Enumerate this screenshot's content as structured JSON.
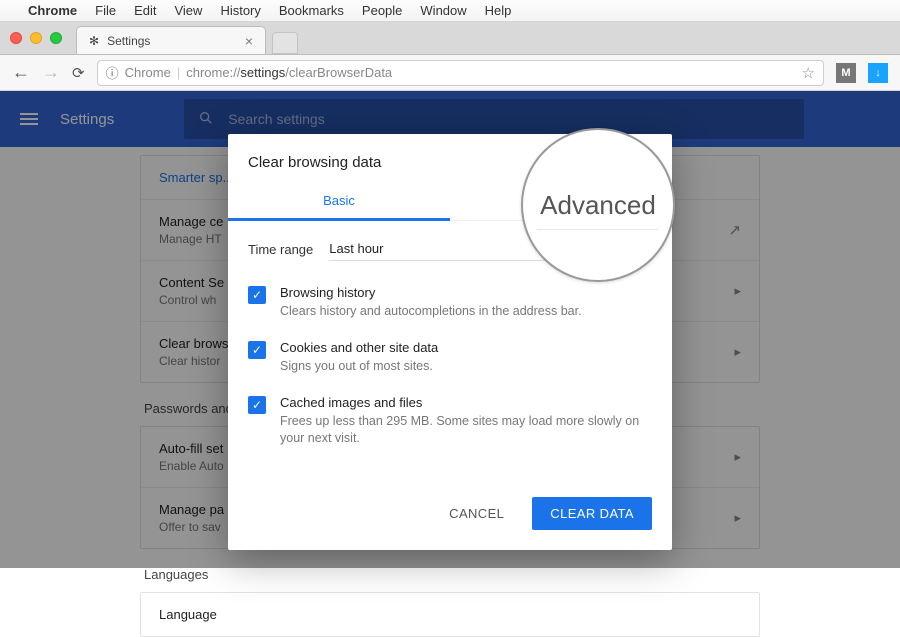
{
  "mac_menu": {
    "app": "Chrome",
    "items": [
      "File",
      "Edit",
      "View",
      "History",
      "Bookmarks",
      "People",
      "Window",
      "Help"
    ]
  },
  "tab": {
    "title": "Settings"
  },
  "omnibox": {
    "scheme_label": "Chrome",
    "pre": "chrome://",
    "bold": "settings",
    "post": "/clearBrowserData"
  },
  "header": {
    "title": "Settings",
    "search_placeholder": "Search settings"
  },
  "bg_rows": {
    "r0": {
      "title": "Smarter sp..."
    },
    "r1": {
      "title": "Manage ce",
      "sub": "Manage HT"
    },
    "r2": {
      "title": "Content Se",
      "sub": "Control wh"
    },
    "r3": {
      "title": "Clear brows",
      "sub": "Clear histor"
    },
    "sect1": "Passwords and",
    "r4": {
      "title": "Auto-fill set",
      "sub": "Enable Auto"
    },
    "r5": {
      "title": "Manage pa",
      "sub": "Offer to sav"
    },
    "sect2": "Languages",
    "r6": {
      "title": "Language"
    }
  },
  "dialog": {
    "title": "Clear browsing data",
    "tab_basic": "Basic",
    "tab_advanced": "Advanced",
    "time_label": "Time range",
    "time_value": "Last hour",
    "opts": [
      {
        "title": "Browsing history",
        "sub": "Clears history and autocompletions in the address bar."
      },
      {
        "title": "Cookies and other site data",
        "sub": "Signs you out of most sites."
      },
      {
        "title": "Cached images and files",
        "sub": "Frees up less than 295 MB. Some sites may load more slowly on your next visit."
      }
    ],
    "cancel": "CANCEL",
    "confirm": "CLEAR DATA"
  },
  "lens": "Advanced"
}
